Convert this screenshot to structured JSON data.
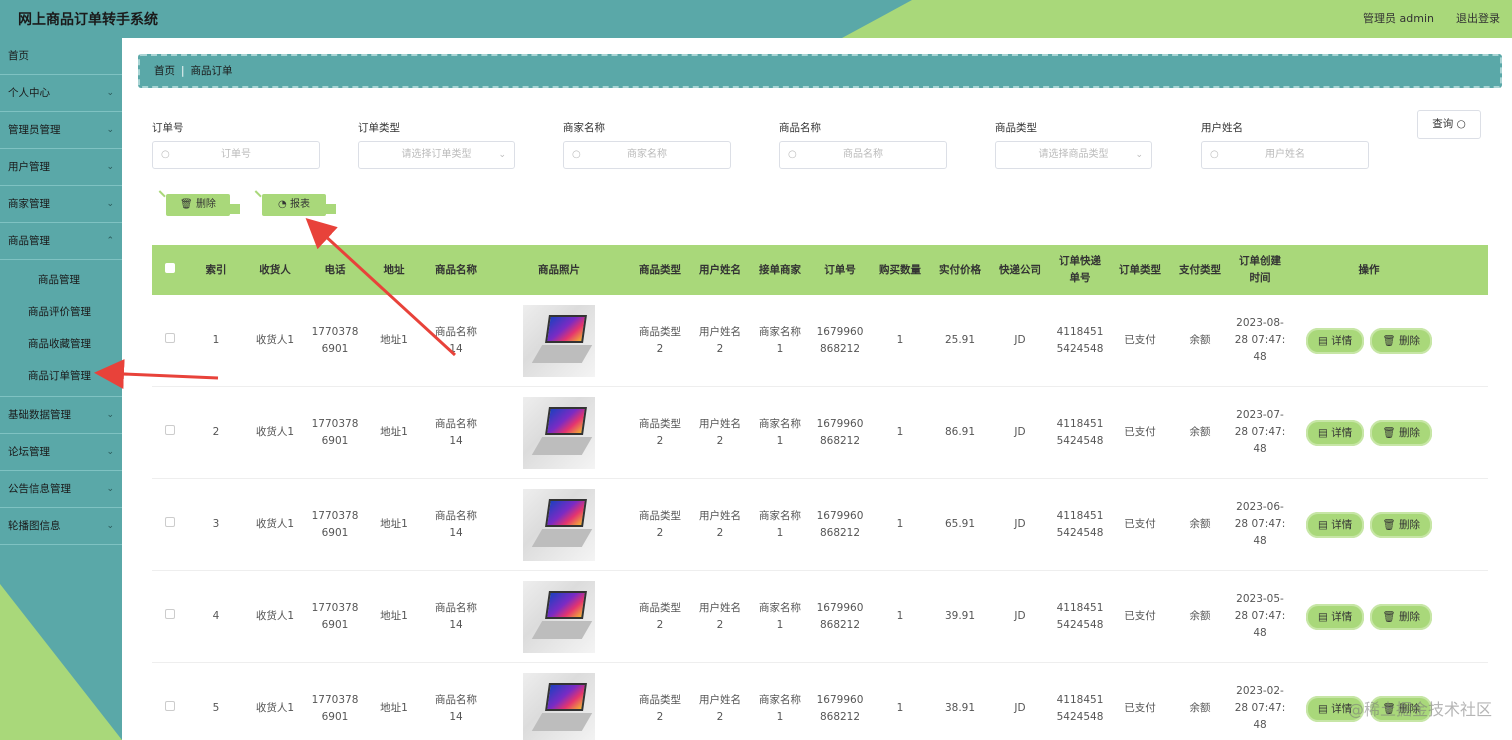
{
  "header": {
    "title": "网上商品订单转手系统",
    "admin": "管理员 admin",
    "logout": "退出登录"
  },
  "sidebar": {
    "items": [
      {
        "label": "首页",
        "chev": ""
      },
      {
        "label": "个人中心",
        "chev": "⌄"
      },
      {
        "label": "管理员管理",
        "chev": "⌄"
      },
      {
        "label": "用户管理",
        "chev": "⌄"
      },
      {
        "label": "商家管理",
        "chev": "⌄"
      },
      {
        "label": "商品管理",
        "chev": "⌃"
      }
    ],
    "sub_items": [
      "商品管理",
      "商品评价管理",
      "商品收藏管理",
      "商品订单管理"
    ],
    "items_after": [
      {
        "label": "基础数据管理",
        "chev": "⌄"
      },
      {
        "label": "论坛管理",
        "chev": "⌄"
      },
      {
        "label": "公告信息管理",
        "chev": "⌄"
      },
      {
        "label": "轮播图信息",
        "chev": "⌄"
      }
    ]
  },
  "breadcrumb": {
    "home": "首页",
    "sep": "|",
    "current": "商品订单"
  },
  "search": {
    "fields": [
      {
        "label": "订单号",
        "placeholder": "订单号",
        "type": "input"
      },
      {
        "label": "订单类型",
        "placeholder": "请选择订单类型",
        "type": "select"
      },
      {
        "label": "商家名称",
        "placeholder": "商家名称",
        "type": "input"
      },
      {
        "label": "商品名称",
        "placeholder": "商品名称",
        "type": "input"
      },
      {
        "label": "商品类型",
        "placeholder": "请选择商品类型",
        "type": "select"
      },
      {
        "label": "用户姓名",
        "placeholder": "用户姓名",
        "type": "input"
      }
    ],
    "query_label": "查询"
  },
  "actions": {
    "delete_label": "删除",
    "report_label": "报表"
  },
  "table": {
    "headers": [
      "索引",
      "收货人",
      "电话",
      "地址",
      "商品名称",
      "商品照片",
      "商品类型",
      "用户姓名",
      "接单商家",
      "订单号",
      "购买数量",
      "实付价格",
      "快递公司",
      "订单快递\n单号",
      "订单类型",
      "支付类型",
      "订单创建\n时间",
      "操作"
    ],
    "rows": [
      {
        "index": "1",
        "receiver": "收货人1",
        "phone": "1770378\n6901",
        "address": "地址1",
        "product": "商品名称\n14",
        "ptype": "商品类型\n2",
        "user": "用户姓名\n2",
        "merchant": "商家名称\n1",
        "order_no": "1679960\n868212",
        "qty": "1",
        "price": "25.91",
        "express": "JD",
        "tracking": "4118451\n5424548",
        "order_type": "已支付",
        "pay_type": "余额",
        "created": "2023-08-\n28 07:47:\n48"
      },
      {
        "index": "2",
        "receiver": "收货人1",
        "phone": "1770378\n6901",
        "address": "地址1",
        "product": "商品名称\n14",
        "ptype": "商品类型\n2",
        "user": "用户姓名\n2",
        "merchant": "商家名称\n1",
        "order_no": "1679960\n868212",
        "qty": "1",
        "price": "86.91",
        "express": "JD",
        "tracking": "4118451\n5424548",
        "order_type": "已支付",
        "pay_type": "余额",
        "created": "2023-07-\n28 07:47:\n48"
      },
      {
        "index": "3",
        "receiver": "收货人1",
        "phone": "1770378\n6901",
        "address": "地址1",
        "product": "商品名称\n14",
        "ptype": "商品类型\n2",
        "user": "用户姓名\n2",
        "merchant": "商家名称\n1",
        "order_no": "1679960\n868212",
        "qty": "1",
        "price": "65.91",
        "express": "JD",
        "tracking": "4118451\n5424548",
        "order_type": "已支付",
        "pay_type": "余额",
        "created": "2023-06-\n28 07:47:\n48"
      },
      {
        "index": "4",
        "receiver": "收货人1",
        "phone": "1770378\n6901",
        "address": "地址1",
        "product": "商品名称\n14",
        "ptype": "商品类型\n2",
        "user": "用户姓名\n2",
        "merchant": "商家名称\n1",
        "order_no": "1679960\n868212",
        "qty": "1",
        "price": "39.91",
        "express": "JD",
        "tracking": "4118451\n5424548",
        "order_type": "已支付",
        "pay_type": "余额",
        "created": "2023-05-\n28 07:47:\n48"
      },
      {
        "index": "5",
        "receiver": "收货人1",
        "phone": "1770378\n6901",
        "address": "地址1",
        "product": "商品名称\n14",
        "ptype": "商品类型\n2",
        "user": "用户姓名\n2",
        "merchant": "商家名称\n1",
        "order_no": "1679960\n868212",
        "qty": "1",
        "price": "38.91",
        "express": "JD",
        "tracking": "4118451\n5424548",
        "order_type": "已支付",
        "pay_type": "余额",
        "created": "2023-02-\n28 07:47:\n48"
      }
    ],
    "detail_label": "详情",
    "row_delete_label": "删除"
  },
  "watermark": "@稀土掘金技术社区",
  "colors": {
    "teal": "#5aa8a8",
    "green": "#a9d87a",
    "arrow": "#e8423a"
  },
  "icons": {
    "search": "search-icon",
    "trash": "trash-icon",
    "chart": "chart-icon",
    "detail": "document-icon",
    "chevron": "chevron-down-icon"
  }
}
